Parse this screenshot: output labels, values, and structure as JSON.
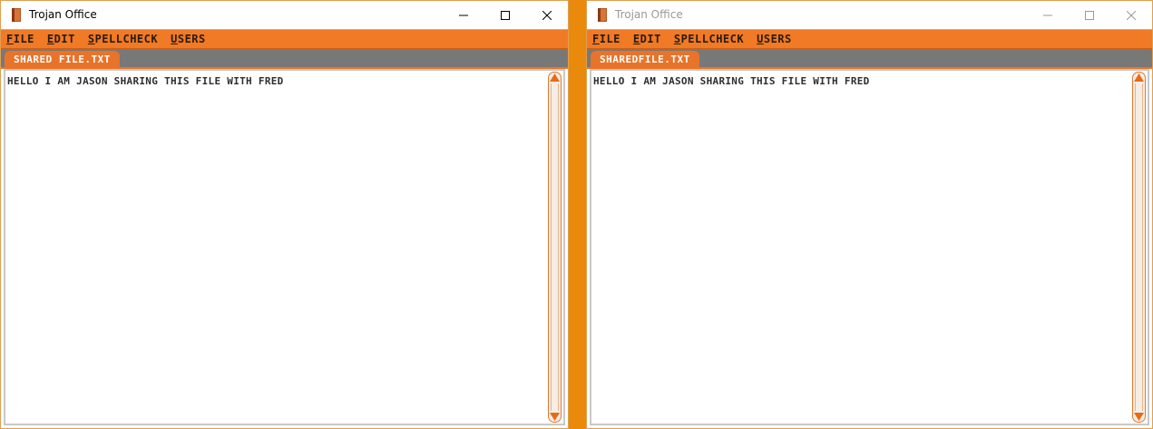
{
  "colors": {
    "accent": "#f07a25",
    "desktop": "#ea8a0c",
    "tabbar": "#787878"
  },
  "windows": [
    {
      "title": "Trojan Office",
      "active": true,
      "menu": [
        {
          "mnemonic": "F",
          "rest": "ILE"
        },
        {
          "mnemonic": "E",
          "rest": "DIT"
        },
        {
          "mnemonic": "S",
          "rest": "PELLCHECK"
        },
        {
          "mnemonic": "U",
          "rest": "SERS"
        }
      ],
      "tab_label": "SHARED FILE.TXT",
      "content": "HELLO I AM JASON SHARING THIS FILE WITH FRED"
    },
    {
      "title": "Trojan Office",
      "active": false,
      "menu": [
        {
          "mnemonic": "F",
          "rest": "ILE"
        },
        {
          "mnemonic": "E",
          "rest": "DIT"
        },
        {
          "mnemonic": "S",
          "rest": "PELLCHECK"
        },
        {
          "mnemonic": "U",
          "rest": "SERS"
        }
      ],
      "tab_label": "SHAREDFILE.TXT",
      "content": "HELLO I AM JASON SHARING THIS FILE WITH FRED"
    }
  ],
  "icons": {
    "app": "app-book-icon",
    "minimize": "minimize-icon",
    "maximize": "maximize-icon",
    "close": "close-icon",
    "scroll_up": "arrow-up-icon",
    "scroll_down": "arrow-down-icon"
  }
}
